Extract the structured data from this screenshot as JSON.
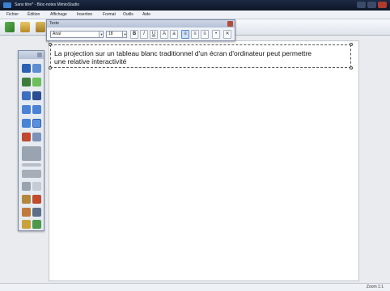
{
  "window": {
    "title": "Sans titre* - Bloc-notes MimioStudio"
  },
  "colors": {
    "titlebar": "#1c2a44",
    "accent_blue": "#3d7fd0",
    "toolbar_bg": "#e4e8ef",
    "canvas": "#ffffff",
    "workspace": "#e9ebee"
  },
  "menubar": {
    "items": [
      {
        "label": "Fichier"
      },
      {
        "label": "Édition"
      },
      {
        "label": "Affichage"
      },
      {
        "label": "Insertion"
      },
      {
        "label": "Format"
      },
      {
        "label": "Outils"
      },
      {
        "label": "Aide"
      }
    ]
  },
  "toolbar": {
    "icons": [
      "back-arrow-icon",
      "save-icon",
      "print-icon"
    ]
  },
  "text_panel": {
    "title": "Texte",
    "font": "Arial",
    "size": "18",
    "buttons": [
      {
        "icon": "bold-icon",
        "glyph": "B"
      },
      {
        "icon": "italic-icon",
        "glyph": "I"
      },
      {
        "icon": "underline-icon",
        "glyph": "U"
      },
      {
        "icon": "grow-font-icon",
        "glyph": "A"
      },
      {
        "icon": "shrink-font-icon",
        "glyph": "a"
      },
      {
        "icon": "align-left-icon",
        "glyph": "≡"
      },
      {
        "icon": "align-center-icon",
        "glyph": "≡"
      },
      {
        "icon": "align-right-icon",
        "glyph": "≡"
      },
      {
        "icon": "bullets-icon",
        "glyph": "•"
      },
      {
        "icon": "clear-format-icon",
        "glyph": "✕"
      }
    ]
  },
  "document": {
    "text_line1": "La projection sur un tableau blanc traditionnel d'un écran d'ordinateur peut permettre",
    "text_line2": "une relative interactivité"
  },
  "tool_palette": {
    "tools": [
      "select-arrow-icon",
      "zoom-icon",
      "pen-icon",
      "highlighter-icon",
      "eraser-icon",
      "line-icon",
      "rectangle-icon",
      "ellipse-icon",
      "triangle-icon",
      "text-tool-icon",
      "shape-recognizer-icon",
      "image-icon",
      "color-swatch-icon",
      "thickness-slider-icon",
      "transparency-grid-icon",
      "hand-tool-icon",
      "spotlight-icon",
      "gallery-icon",
      "delete-icon",
      "reveal-icon",
      "monitor-icon",
      "record-icon",
      "gesture-icon"
    ]
  },
  "statusbar": {
    "zoom": "Zoom 1:1"
  }
}
